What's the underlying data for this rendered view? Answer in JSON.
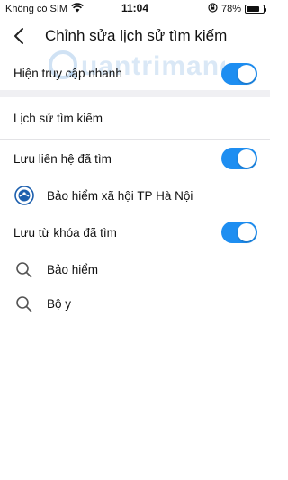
{
  "status_bar": {
    "carrier": "Không có SIM",
    "time": "11:04",
    "battery": "78%",
    "battery_level": 0.78
  },
  "header": {
    "title": "Chỉnh sửa lịch sử tìm kiếm"
  },
  "quick_access": {
    "label": "Hiện truy cập nhanh",
    "enabled": true
  },
  "history": {
    "section_title": "Lịch sử tìm kiếm",
    "saved_contacts": {
      "label": "Lưu liên hệ đã tìm",
      "enabled": true,
      "items": [
        {
          "name": "Bảo hiểm xã hội TP Hà Nội"
        }
      ]
    },
    "saved_keywords": {
      "label": "Lưu từ khóa đã tìm",
      "enabled": true,
      "items": [
        {
          "keyword": "Bảo hiểm"
        },
        {
          "keyword": "Bộ y"
        }
      ]
    }
  },
  "watermark": "Quantrimang",
  "colors": {
    "accent": "#1e8ef1",
    "section_bg": "#f0f0f3",
    "logo_blue": "#1c5fae"
  }
}
